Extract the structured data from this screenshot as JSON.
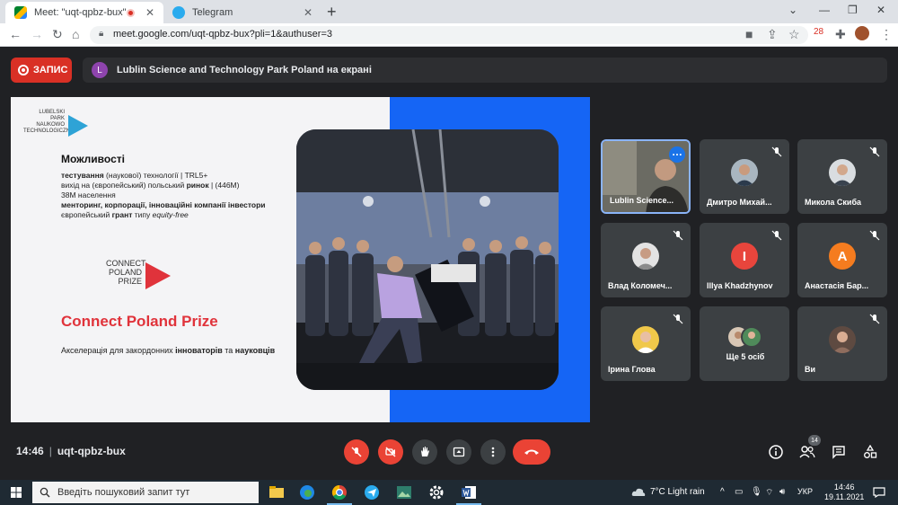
{
  "browser": {
    "tabs": [
      {
        "title": "Meet: \"uqt-qpbz-bux\"",
        "active": true,
        "favicon": "google-meet-icon"
      },
      {
        "title": "Telegram",
        "active": false,
        "favicon": "telegram-icon"
      }
    ],
    "url": "meet.google.com/uqt-qpbz-bux?pli=1&authuser=3",
    "extension_badge": "28"
  },
  "meet": {
    "record_label": "ЗАПИС",
    "presenter_initial": "L",
    "presenting_text": "Lublin Science and Technology Park Poland на екрані",
    "time": "14:46",
    "meeting_code": "uqt-qpbz-bux",
    "participants_count": "14",
    "tiles": [
      {
        "name": "Lublin Science...",
        "type": "video",
        "speaking": true
      },
      {
        "name": "Дмитро Михай...",
        "type": "photo",
        "muted": true
      },
      {
        "name": "Микола Скиба",
        "type": "photo",
        "muted": true
      },
      {
        "name": "Влад Коломеч...",
        "type": "photo",
        "muted": true
      },
      {
        "name": "Illya Khadzhynov",
        "type": "letter",
        "letter": "I",
        "color": "#e8453c",
        "muted": true
      },
      {
        "name": "Анастасія Бар...",
        "type": "letter",
        "letter": "A",
        "color": "#f57c1f",
        "muted": true
      },
      {
        "name": "Ірина Глова",
        "type": "photo",
        "muted": true
      },
      {
        "name": "Ще 5 осіб",
        "type": "group",
        "muted": false
      },
      {
        "name": "Ви",
        "type": "photo",
        "muted": true
      }
    ]
  },
  "slide": {
    "logo1_lines": [
      "LUBELSKI",
      "PARK",
      "NAUKOWO",
      "TECHNOLOGICZNY"
    ],
    "heading": "Можливості",
    "line1_bold": "тестування",
    "line1_rest": " (наукової) технології | TRL5+",
    "line2_a": "вихід на (європейський) польський ",
    "line2_bold": "ринок",
    "line2_b": " | (446M)",
    "line3": "38M населення",
    "line4_bold": "менторинг, корпорації, інноваційні компанії інвестори",
    "line5_a": "європейський ",
    "line5_bold": "грант",
    "line5_b": " типу ",
    "line5_italic": "equity-free",
    "cpp_logo_lines": [
      "CONNECT",
      "POLAND",
      "PRIZE"
    ],
    "cpp_title": "Connect Poland Prize",
    "cpp_sub_a": "Акселерація для закордонних ",
    "cpp_sub_bold1": "інноваторів",
    "cpp_sub_b": " та ",
    "cpp_sub_bold2": "науковців"
  },
  "taskbar": {
    "search_placeholder": "Введіть пошуковий запит тут",
    "weather": "7°C  Light rain",
    "lang": "УКР",
    "time": "14:46",
    "date": "19.11.2021"
  }
}
